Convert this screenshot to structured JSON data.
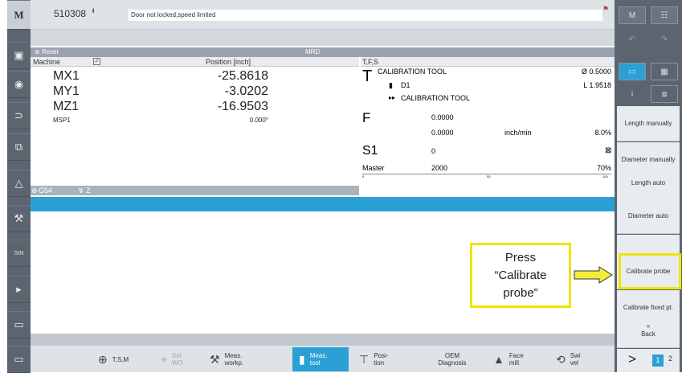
{
  "header": {
    "program": "510308",
    "alarm_text": "Door not locked,speed limited"
  },
  "mrd": {
    "reset": "Reset",
    "mode": "MRD"
  },
  "position": {
    "header_machine": "Machine",
    "header_position": "Position [inch]",
    "axes": [
      {
        "name": "MX1",
        "value": "-25.8618"
      },
      {
        "name": "MY1",
        "value": "-3.0202"
      },
      {
        "name": "MZ1",
        "value": "-16.9503"
      },
      {
        "name": "MSP1",
        "value": "0.000°"
      }
    ],
    "wcs": "G54",
    "wcs_axis": "Z"
  },
  "tfs": {
    "header": "T,F,S",
    "t_label": "T",
    "tool_name": "CALIBRATION TOOL",
    "tool_dia": "Ø 0.5000",
    "d_label": "D1",
    "tool_len": "L 1.9518",
    "next_tool": "CALIBRATION TOOL",
    "f_label": "F",
    "f_value": "0.0000",
    "f_value2": "0.0000",
    "f_unit": "inch/min",
    "f_pct": "8.0%",
    "s_label": "S1",
    "s_value": "0",
    "master_label": "Master",
    "master_value": "2000",
    "master_pct": "70%",
    "scale_min": "0",
    "scale_mid": "50",
    "scale_max": "100"
  },
  "vsoftkeys": [
    "Length manually",
    "Diameter manually",
    "Length auto",
    "Diameter auto",
    "",
    "Calibrate probe",
    "Calibrate fixed pt.",
    "Back"
  ],
  "hsoftkeys": [
    {
      "label": "T,S,M"
    },
    {
      "label": "Set WO"
    },
    {
      "label": "Meas. workp."
    },
    {
      "label": "Meas. tool"
    },
    {
      "label": "Posi- tion"
    },
    {
      "label": "OEM Diagnosis"
    },
    {
      "label": "Face mill."
    },
    {
      "label": "Swi vel"
    }
  ],
  "callout": {
    "line1": "Press",
    "line2": "“Calibrate",
    "line3": "probe”"
  },
  "pager": {
    "next": ">",
    "p1": "1",
    "p2": "2"
  },
  "colors": {
    "accent": "#2aa0d4",
    "highlight": "#f0e400"
  }
}
